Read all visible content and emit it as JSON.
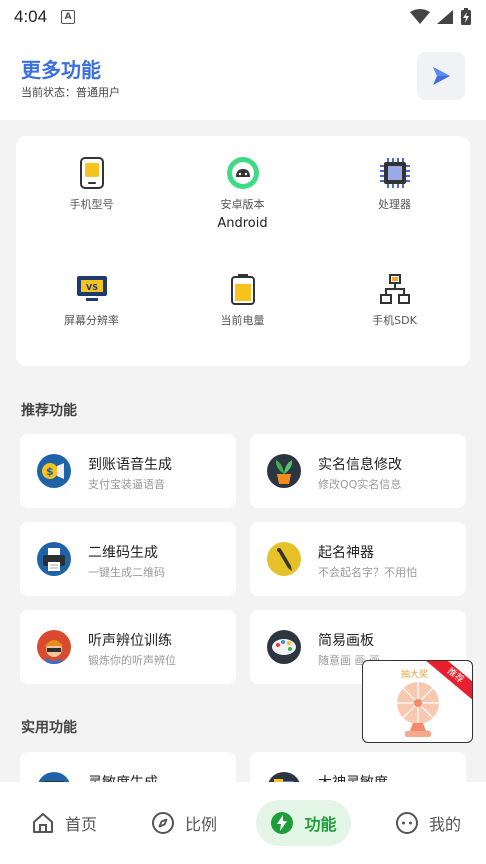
{
  "status_bar": {
    "time": "4:04",
    "notification_badge": "A",
    "icons": [
      "wifi-icon",
      "signal-icon",
      "battery-charging-icon"
    ]
  },
  "header": {
    "title": "更多功能",
    "subtitle": "当前状态：普通用户",
    "play_icon": "play-icon"
  },
  "device_info": [
    {
      "label": "手机型号",
      "value": "",
      "icon": "phone-icon"
    },
    {
      "label": "安卓版本",
      "value": "Android",
      "icon": "android-icon"
    },
    {
      "label": "处理器",
      "value": "",
      "icon": "cpu-icon"
    },
    {
      "label": "屏幕分辨率",
      "value": "",
      "icon": "monitor-icon"
    },
    {
      "label": "当前电量",
      "value": "",
      "icon": "battery-icon"
    },
    {
      "label": "手机SDK",
      "value": "",
      "icon": "network-icon"
    }
  ],
  "sections": {
    "recommended": "推荐功能",
    "utility": "实用功能"
  },
  "recommended": [
    {
      "name": "到账语音生成",
      "desc": "支付宝装逼语音",
      "icon": "money-voice-icon"
    },
    {
      "name": "实名信息修改",
      "desc": "修改QQ实名信息",
      "icon": "plant-icon"
    },
    {
      "name": "二维码生成",
      "desc": "一键生成二维码",
      "icon": "printer-icon"
    },
    {
      "name": "起名神器",
      "desc": "不会起名字？不用怕",
      "icon": "pen-icon"
    },
    {
      "name": "听声辨位训练",
      "desc": "锻炼你的听声辨位",
      "icon": "soldier-icon"
    },
    {
      "name": "简易画板",
      "desc": "随意画 画 画~",
      "icon": "palette-icon"
    }
  ],
  "utility": [
    {
      "name": "灵敏度生成",
      "icon": "monitor-app-icon"
    },
    {
      "name": "大神灵敏度",
      "icon": "folder-app-icon"
    }
  ],
  "float_ad": {
    "text": "抽大奖",
    "badge": "推荐"
  },
  "nav": [
    {
      "label": "首页",
      "icon": "home-icon"
    },
    {
      "label": "比例",
      "icon": "compass-icon"
    },
    {
      "label": "功能",
      "icon": "bolt-icon"
    },
    {
      "label": "我的",
      "icon": "face-icon"
    }
  ],
  "colors": {
    "accent_blue": "#3c6fe0",
    "active_green": "#1f9d3a",
    "active_bg": "#e3f5e5",
    "background": "#f3f3f3"
  }
}
